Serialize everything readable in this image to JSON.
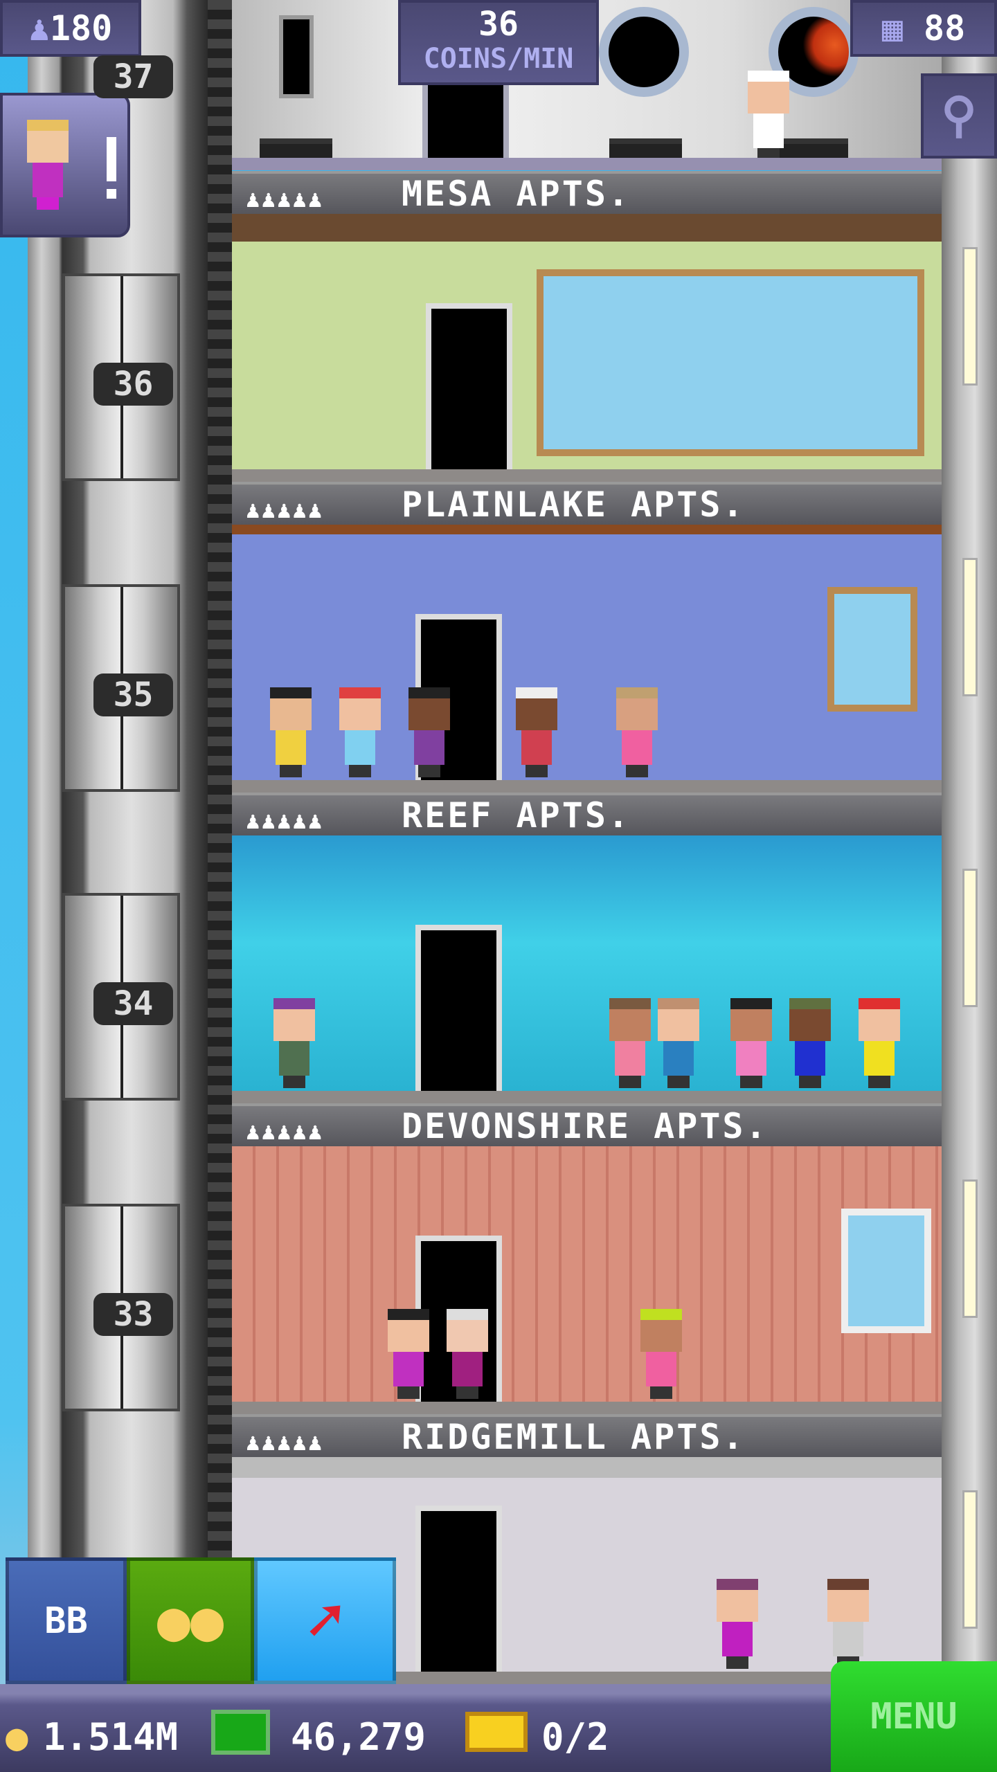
{
  "hud": {
    "population": "180",
    "coins_per_min_value": "36",
    "coins_per_min_label": "COINS/MIN",
    "floors_count": "88"
  },
  "elevator": {
    "floor_numbers": [
      "37",
      "36",
      "35",
      "34",
      "33"
    ]
  },
  "floors": [
    {
      "name": "MESA APTS.",
      "theme": "mesa"
    },
    {
      "name": "PLAINLAKE APTS.",
      "theme": "plainlake"
    },
    {
      "name": "REEF APTS.",
      "theme": "reef"
    },
    {
      "name": "DEVONSHIRE APTS.",
      "theme": "devonshire"
    },
    {
      "name": "RIDGEMILL APTS.",
      "theme": "ridgemill"
    }
  ],
  "resident_icons": "♟♟♟♟♟",
  "buttons": {
    "bitbook": "BB",
    "coins": "coins-icon",
    "elevator": "arrow-icon",
    "menu": "MENU"
  },
  "currency": {
    "coins": "1.514M",
    "bux": "46,279",
    "tickets": "0/2"
  },
  "colors": {
    "badge": "#4a4872",
    "menu": "#22c022",
    "bar": "#4a4872"
  }
}
